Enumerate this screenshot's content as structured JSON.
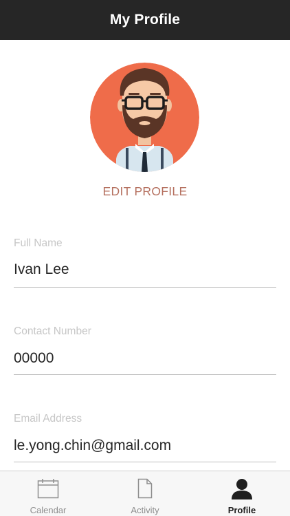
{
  "header": {
    "title": "My Profile"
  },
  "profile": {
    "avatar_icon": "bearded-man-avatar",
    "edit_label": "EDIT PROFILE"
  },
  "fields": {
    "full_name": {
      "label": "Full Name",
      "value": "Ivan Lee"
    },
    "contact_number": {
      "label": "Contact Number",
      "value": "00000"
    },
    "email": {
      "label": "Email Address",
      "value": "le.yong.chin@gmail.com"
    }
  },
  "tabs": [
    {
      "label": "Calendar",
      "icon": "calendar-icon",
      "active": false
    },
    {
      "label": "Activity",
      "icon": "document-icon",
      "active": false
    },
    {
      "label": "Profile",
      "icon": "person-icon",
      "active": true
    }
  ],
  "colors": {
    "header_bg": "#262626",
    "avatar_bg": "#ef6c4a",
    "edit_link": "#b5705f"
  }
}
